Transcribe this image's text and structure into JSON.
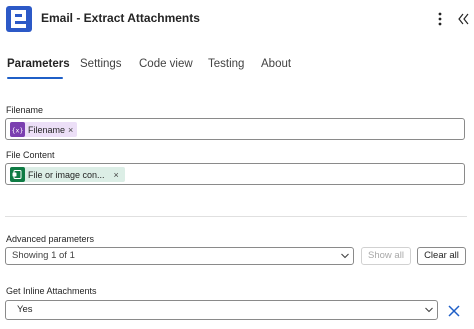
{
  "header": {
    "title": "Email - Extract Attachments",
    "more_icon": "more-vertical-icon",
    "collapse_icon": "double-chevron-left-icon",
    "app_icon": "app-logo-icon"
  },
  "tabs": [
    {
      "label": "Parameters",
      "active": true
    },
    {
      "label": "Settings",
      "active": false
    },
    {
      "label": "Code view",
      "active": false
    },
    {
      "label": "Testing",
      "active": false
    },
    {
      "label": "About",
      "active": false
    }
  ],
  "fields": {
    "filename": {
      "label": "Filename",
      "token": {
        "label": "Filename",
        "icon": "expression-icon",
        "remove": "×"
      }
    },
    "file_content": {
      "label": "File Content",
      "token": {
        "label": "File or image con...",
        "icon": "data-source-icon",
        "remove": "×"
      }
    }
  },
  "advanced": {
    "label": "Advanced parameters",
    "selected": "Showing 1 of 1",
    "show_all_label": "Show all",
    "clear_all_label": "Clear all"
  },
  "inline_attachments": {
    "label": "Get Inline Attachments",
    "value": "Yes"
  },
  "colors": {
    "accent": "#1f5fc7",
    "token_purple": "#ecdff7",
    "token_green": "#dceee6",
    "icon_purple": "#7b3fb0",
    "icon_green": "#0f7b44",
    "app_icon": "#2c59c7"
  }
}
